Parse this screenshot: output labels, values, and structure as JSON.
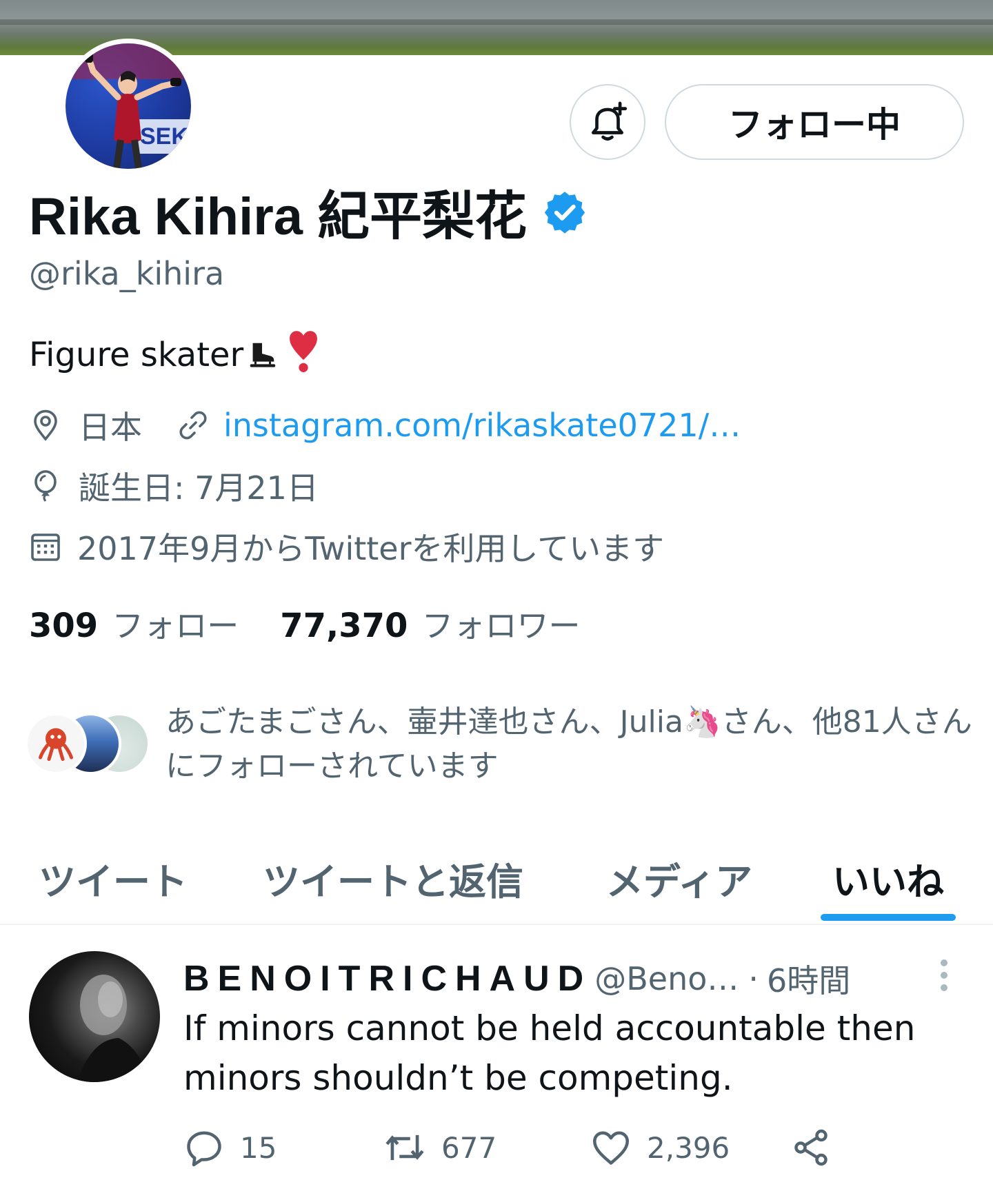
{
  "profile": {
    "display_name": "Rika Kihira 紀平梨花",
    "handle": "@rika_kihira",
    "bio_text": "Figure skater",
    "bio_emoji_heart": "❣️",
    "location": "日本",
    "website": "instagram.com/rikaskate0721/…",
    "birthday": "誕生日: 7月21日",
    "joined": "2017年9月からTwitterを利用しています",
    "following_count": "309",
    "following_label": "フォロー",
    "followers_count": "77,370",
    "followers_label": "フォロワー",
    "verified_icon": "verified-badge-icon"
  },
  "actions": {
    "notify_icon": "bell-plus-icon",
    "follow_label": "フォロー中"
  },
  "mutual": {
    "text": "あごたまごさん、壷井達也さん、Julia🦄さん、他81人さんにフォローされています"
  },
  "tabs": [
    {
      "label": "ツイート",
      "active": false
    },
    {
      "label": "ツイートと返信",
      "active": false
    },
    {
      "label": "メディア",
      "active": false
    },
    {
      "label": "いいね",
      "active": true
    }
  ],
  "tweet": {
    "name": "BENOITRICHAUD",
    "handle": "@Beno…",
    "dot": "·",
    "time": "6時間",
    "text": "If minors cannot be held accountable then minors shouldn’t be competing.",
    "replies": "15",
    "retweets": "677",
    "likes": "2,396"
  },
  "colors": {
    "accent": "#1d9bf0",
    "text_primary": "#0f1419",
    "text_secondary": "#536471",
    "border": "#cfd9de"
  }
}
